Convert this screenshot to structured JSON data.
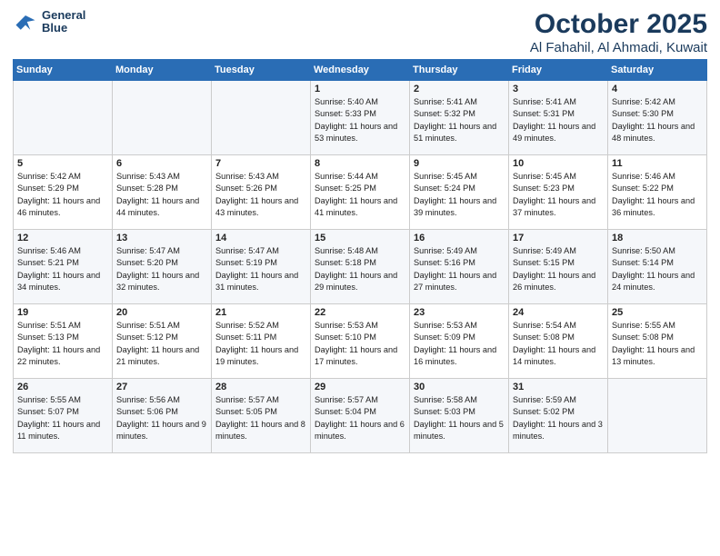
{
  "header": {
    "logo_line1": "General",
    "logo_line2": "Blue",
    "month": "October 2025",
    "location": "Al Fahahil, Al Ahmadi, Kuwait"
  },
  "days_of_week": [
    "Sunday",
    "Monday",
    "Tuesday",
    "Wednesday",
    "Thursday",
    "Friday",
    "Saturday"
  ],
  "weeks": [
    [
      {
        "day": "",
        "info": ""
      },
      {
        "day": "",
        "info": ""
      },
      {
        "day": "",
        "info": ""
      },
      {
        "day": "1",
        "info": "Sunrise: 5:40 AM\nSunset: 5:33 PM\nDaylight: 11 hours and 53 minutes."
      },
      {
        "day": "2",
        "info": "Sunrise: 5:41 AM\nSunset: 5:32 PM\nDaylight: 11 hours and 51 minutes."
      },
      {
        "day": "3",
        "info": "Sunrise: 5:41 AM\nSunset: 5:31 PM\nDaylight: 11 hours and 49 minutes."
      },
      {
        "day": "4",
        "info": "Sunrise: 5:42 AM\nSunset: 5:30 PM\nDaylight: 11 hours and 48 minutes."
      }
    ],
    [
      {
        "day": "5",
        "info": "Sunrise: 5:42 AM\nSunset: 5:29 PM\nDaylight: 11 hours and 46 minutes."
      },
      {
        "day": "6",
        "info": "Sunrise: 5:43 AM\nSunset: 5:28 PM\nDaylight: 11 hours and 44 minutes."
      },
      {
        "day": "7",
        "info": "Sunrise: 5:43 AM\nSunset: 5:26 PM\nDaylight: 11 hours and 43 minutes."
      },
      {
        "day": "8",
        "info": "Sunrise: 5:44 AM\nSunset: 5:25 PM\nDaylight: 11 hours and 41 minutes."
      },
      {
        "day": "9",
        "info": "Sunrise: 5:45 AM\nSunset: 5:24 PM\nDaylight: 11 hours and 39 minutes."
      },
      {
        "day": "10",
        "info": "Sunrise: 5:45 AM\nSunset: 5:23 PM\nDaylight: 11 hours and 37 minutes."
      },
      {
        "day": "11",
        "info": "Sunrise: 5:46 AM\nSunset: 5:22 PM\nDaylight: 11 hours and 36 minutes."
      }
    ],
    [
      {
        "day": "12",
        "info": "Sunrise: 5:46 AM\nSunset: 5:21 PM\nDaylight: 11 hours and 34 minutes."
      },
      {
        "day": "13",
        "info": "Sunrise: 5:47 AM\nSunset: 5:20 PM\nDaylight: 11 hours and 32 minutes."
      },
      {
        "day": "14",
        "info": "Sunrise: 5:47 AM\nSunset: 5:19 PM\nDaylight: 11 hours and 31 minutes."
      },
      {
        "day": "15",
        "info": "Sunrise: 5:48 AM\nSunset: 5:18 PM\nDaylight: 11 hours and 29 minutes."
      },
      {
        "day": "16",
        "info": "Sunrise: 5:49 AM\nSunset: 5:16 PM\nDaylight: 11 hours and 27 minutes."
      },
      {
        "day": "17",
        "info": "Sunrise: 5:49 AM\nSunset: 5:15 PM\nDaylight: 11 hours and 26 minutes."
      },
      {
        "day": "18",
        "info": "Sunrise: 5:50 AM\nSunset: 5:14 PM\nDaylight: 11 hours and 24 minutes."
      }
    ],
    [
      {
        "day": "19",
        "info": "Sunrise: 5:51 AM\nSunset: 5:13 PM\nDaylight: 11 hours and 22 minutes."
      },
      {
        "day": "20",
        "info": "Sunrise: 5:51 AM\nSunset: 5:12 PM\nDaylight: 11 hours and 21 minutes."
      },
      {
        "day": "21",
        "info": "Sunrise: 5:52 AM\nSunset: 5:11 PM\nDaylight: 11 hours and 19 minutes."
      },
      {
        "day": "22",
        "info": "Sunrise: 5:53 AM\nSunset: 5:10 PM\nDaylight: 11 hours and 17 minutes."
      },
      {
        "day": "23",
        "info": "Sunrise: 5:53 AM\nSunset: 5:09 PM\nDaylight: 11 hours and 16 minutes."
      },
      {
        "day": "24",
        "info": "Sunrise: 5:54 AM\nSunset: 5:08 PM\nDaylight: 11 hours and 14 minutes."
      },
      {
        "day": "25",
        "info": "Sunrise: 5:55 AM\nSunset: 5:08 PM\nDaylight: 11 hours and 13 minutes."
      }
    ],
    [
      {
        "day": "26",
        "info": "Sunrise: 5:55 AM\nSunset: 5:07 PM\nDaylight: 11 hours and 11 minutes."
      },
      {
        "day": "27",
        "info": "Sunrise: 5:56 AM\nSunset: 5:06 PM\nDaylight: 11 hours and 9 minutes."
      },
      {
        "day": "28",
        "info": "Sunrise: 5:57 AM\nSunset: 5:05 PM\nDaylight: 11 hours and 8 minutes."
      },
      {
        "day": "29",
        "info": "Sunrise: 5:57 AM\nSunset: 5:04 PM\nDaylight: 11 hours and 6 minutes."
      },
      {
        "day": "30",
        "info": "Sunrise: 5:58 AM\nSunset: 5:03 PM\nDaylight: 11 hours and 5 minutes."
      },
      {
        "day": "31",
        "info": "Sunrise: 5:59 AM\nSunset: 5:02 PM\nDaylight: 11 hours and 3 minutes."
      },
      {
        "day": "",
        "info": ""
      }
    ]
  ]
}
